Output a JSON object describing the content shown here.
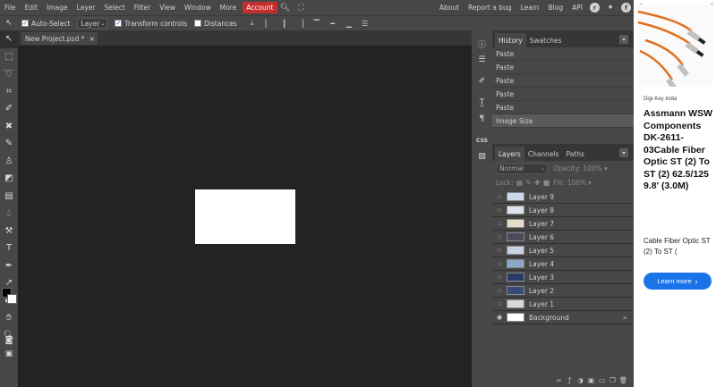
{
  "menu": {
    "items": [
      "File",
      "Edit",
      "Image",
      "Layer",
      "Select",
      "Filter",
      "View",
      "Window",
      "More"
    ],
    "account": "Account",
    "right_links": [
      "About",
      "Report a bug",
      "Learn",
      "Blog",
      "API"
    ]
  },
  "options": {
    "auto_select_label": "Auto-Select",
    "auto_select_value": "Layer",
    "transform_label": "Transform controls",
    "distances_label": "Distances"
  },
  "document": {
    "tab_label": "New Project.psd *",
    "close": "×"
  },
  "history": {
    "tabs": [
      "History",
      "Swatches"
    ],
    "items": [
      "Paste",
      "Paste",
      "Paste",
      "Paste",
      "Paste",
      "Image Size"
    ]
  },
  "layers": {
    "tabs": [
      "Layers",
      "Channels",
      "Paths"
    ],
    "blend_mode": "Normal",
    "opacity_label": "Opacity:",
    "opacity_value": "100%",
    "lock_label": "Lock:",
    "fill_label": "Fill:",
    "fill_value": "100%",
    "items": [
      {
        "name": "Layer 9",
        "visible": false,
        "thumb": "#cfd8e8"
      },
      {
        "name": "Layer 8",
        "visible": false,
        "thumb": "#dde4f0"
      },
      {
        "name": "Layer 7",
        "visible": false,
        "thumb": "#e8dcc8"
      },
      {
        "name": "Layer 6",
        "visible": false,
        "thumb": "#4a4a5a"
      },
      {
        "name": "Layer 5",
        "visible": false,
        "thumb": "#c8d4e6"
      },
      {
        "name": "Layer 4",
        "visible": false,
        "thumb": "#8fa6c8"
      },
      {
        "name": "Layer 3",
        "visible": false,
        "thumb": "#2a3a66"
      },
      {
        "name": "Layer 2",
        "visible": false,
        "thumb": "#3a4a78"
      },
      {
        "name": "Layer 1",
        "visible": false,
        "thumb": "#d8d8d8"
      },
      {
        "name": "Background",
        "visible": true,
        "thumb": "#ffffff",
        "locked": true
      }
    ],
    "footer_icons": [
      "link-icon",
      "effects-icon",
      "adjustment-icon",
      "mask-icon",
      "folder-icon",
      "new-layer-icon",
      "delete-icon"
    ]
  },
  "ad": {
    "distributor": "Digi-Key India",
    "title": "Assmann WSW Components DK-2611-03Cable Fiber Optic ST (2) To ST (2) 62.5/125 9.8' (3.0M)",
    "description": "Cable Fiber Optic ST (2) To ST (",
    "cta": "Learn more",
    "cta_arrow": "›"
  },
  "colors": {
    "panel": "#474747",
    "canvas_bg": "#232323",
    "account": "#c32e2e",
    "ad_button": "#1a73e8"
  }
}
